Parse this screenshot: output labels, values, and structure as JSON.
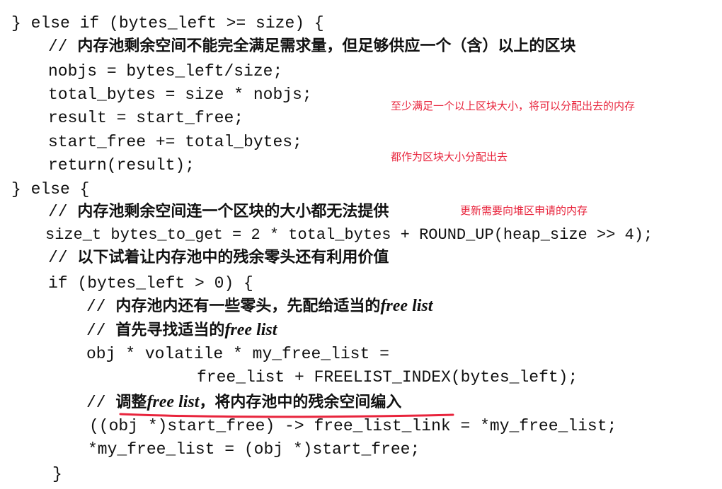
{
  "code": {
    "l1": "} else if (bytes_left >= size) {",
    "l2_cm": "// ",
    "l2_zh": "内存池剩余空间不能完全满足需求量，但足够供应一个（含）以上的区块",
    "l3": "nobjs = bytes_left/size;",
    "l4": "total_bytes = size * nobjs;",
    "l5": "result = start_free;",
    "l6": "start_free += total_bytes;",
    "l7": "return(result);",
    "l8": "} else {",
    "l9_cm": "// ",
    "l9_zh": "内存池剩余空间连一个区块的大小都无法提供",
    "l10": "size_t bytes_to_get = 2 * total_bytes + ROUND_UP(heap_size >> 4);",
    "l11_cm": "// ",
    "l11_zh": "以下试着让内存池中的残余零头还有利用价值",
    "l12": "if (bytes_left > 0) {",
    "l13_cm": "// ",
    "l13_zh": "内存池内还有一些零头，先配给适当的",
    "l13_it": "free list",
    "l14_cm": "// ",
    "l14_zh": "首先寻找适当的",
    "l14_it": "free list",
    "l15": "obj * volatile * my_free_list =",
    "l16": "free_list + FREELIST_INDEX(bytes_left);",
    "l17_cm": "// ",
    "l17_zh1": "调整",
    "l17_it": "free list",
    "l17_zh2": "，将内存池中的残余空间编入",
    "l18": "((obj *)start_free) -> free_list_link = *my_free_list;",
    "l19": "*my_free_list = (obj *)start_free;",
    "l20": "}"
  },
  "annotations": {
    "note1_line1": "至少满足一个以上区块大小，将可以分配出去的内存",
    "note1_line2": "都作为区块大小分配出去",
    "note2": "更新需要向堆区申请的内存"
  },
  "colors": {
    "annotation": "#e8243c",
    "underline": "#e8243c",
    "code": "#111111"
  }
}
